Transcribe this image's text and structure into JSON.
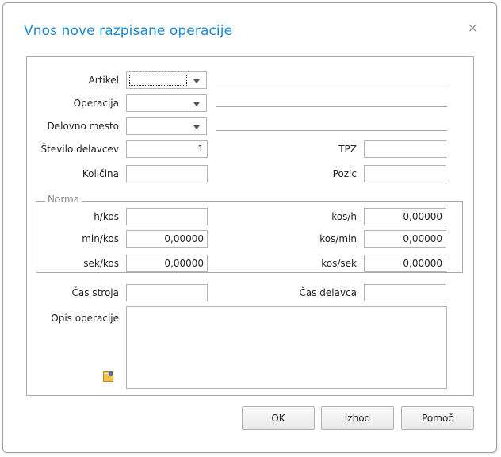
{
  "dialog": {
    "title": "Vnos nove razpisane operacije",
    "close_glyph": "×"
  },
  "form": {
    "artikel": {
      "label": "Artikel",
      "value": ""
    },
    "operacija": {
      "label": "Operacija",
      "value": ""
    },
    "delovno_mesto": {
      "label": "Delovno mesto",
      "value": ""
    },
    "stevilo_delavcev": {
      "label": "Število delavcev",
      "value": "1"
    },
    "tpz": {
      "label": "TPZ",
      "value": ""
    },
    "kolicina": {
      "label": "Količina",
      "value": ""
    },
    "pozic": {
      "label": "Pozic",
      "value": ""
    },
    "norma": {
      "legend": "Norma",
      "h_kos": {
        "label": "h/kos",
        "value": ""
      },
      "kos_h": {
        "label": "kos/h",
        "value": "0,00000"
      },
      "min_kos": {
        "label": "min/kos",
        "value": "0,00000"
      },
      "kos_min": {
        "label": "kos/min",
        "value": "0,00000"
      },
      "sek_kos": {
        "label": "sek/kos",
        "value": "0,00000"
      },
      "kos_sek": {
        "label": "kos/sek",
        "value": "0,00000"
      }
    },
    "cas_stroja": {
      "label": "Čas stroja",
      "value": ""
    },
    "cas_delavca": {
      "label": "Čas delavca",
      "value": ""
    },
    "opis_operacije": {
      "label": "Opis operacije",
      "value": ""
    }
  },
  "buttons": {
    "ok": "OK",
    "izhod": "Izhod",
    "pomoc": "Pomoč"
  },
  "colors": {
    "title": "#1a8ad0",
    "border": "#a9a9a9"
  },
  "icons": {
    "note": "note-edit-icon",
    "close": "close-icon",
    "dropdown": "chevron-down-icon"
  }
}
